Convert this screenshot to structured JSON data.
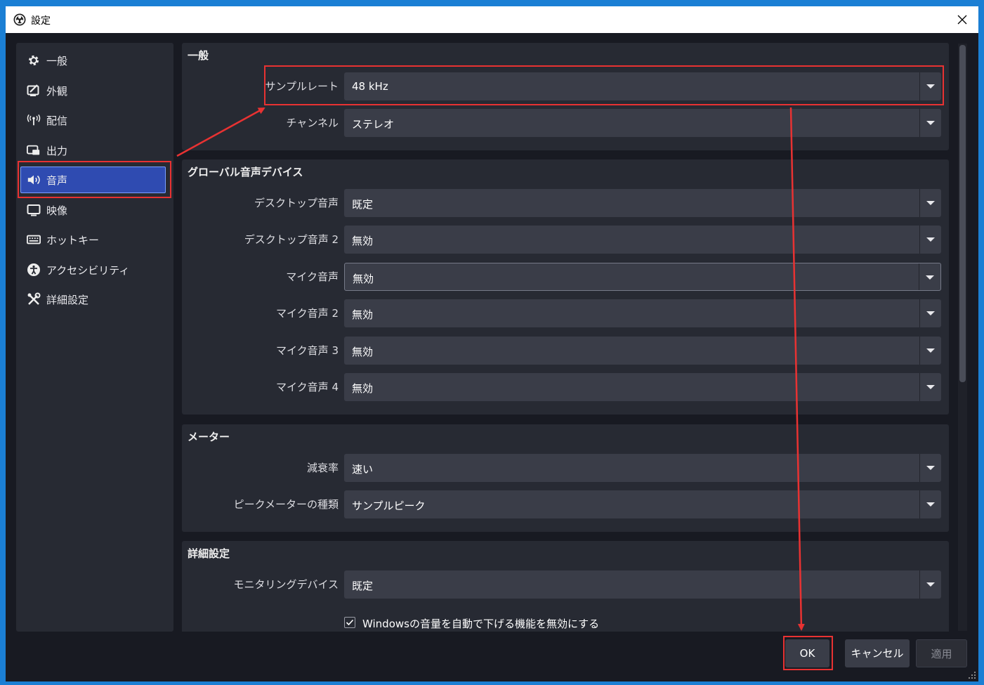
{
  "window": {
    "title": "設定"
  },
  "sidebar": {
    "items": [
      {
        "label": "一般",
        "icon": "gear-icon"
      },
      {
        "label": "外観",
        "icon": "appearance-icon"
      },
      {
        "label": "配信",
        "icon": "broadcast-icon"
      },
      {
        "label": "出力",
        "icon": "output-icon"
      },
      {
        "label": "音声",
        "icon": "speaker-icon",
        "active": true
      },
      {
        "label": "映像",
        "icon": "monitor-icon"
      },
      {
        "label": "ホットキー",
        "icon": "keyboard-icon"
      },
      {
        "label": "アクセシビリティ",
        "icon": "accessibility-icon"
      },
      {
        "label": "詳細設定",
        "icon": "tools-icon"
      }
    ]
  },
  "general": {
    "title": "一般",
    "sample_rate_label": "サンプルレート",
    "sample_rate_value": "48 kHz",
    "channels_label": "チャンネル",
    "channels_value": "ステレオ"
  },
  "global_audio": {
    "title": "グローバル音声デバイス",
    "desktop1_label": "デスクトップ音声",
    "desktop1_value": "既定",
    "desktop2_label": "デスクトップ音声 2",
    "desktop2_value": "無効",
    "mic1_label": "マイク音声",
    "mic1_value": "無効",
    "mic2_label": "マイク音声 2",
    "mic2_value": "無効",
    "mic3_label": "マイク音声 3",
    "mic3_value": "無効",
    "mic4_label": "マイク音声 4",
    "mic4_value": "無効"
  },
  "meters": {
    "title": "メーター",
    "decay_label": "減衰率",
    "decay_value": "速い",
    "peak_label": "ピークメーターの種類",
    "peak_value": "サンプルピーク"
  },
  "advanced": {
    "title": "詳細設定",
    "monitoring_label": "モニタリングデバイス",
    "monitoring_value": "既定",
    "ducking_label": "Windowsの音量を自動で下げる機能を無効にする",
    "ducking_checked": true
  },
  "buttons": {
    "ok": "OK",
    "cancel": "キャンセル",
    "apply": "適用"
  },
  "colors": {
    "annotation": "#e83232",
    "active_item": "#2f4bb1",
    "background": "#181a22",
    "panel": "#272a33"
  }
}
